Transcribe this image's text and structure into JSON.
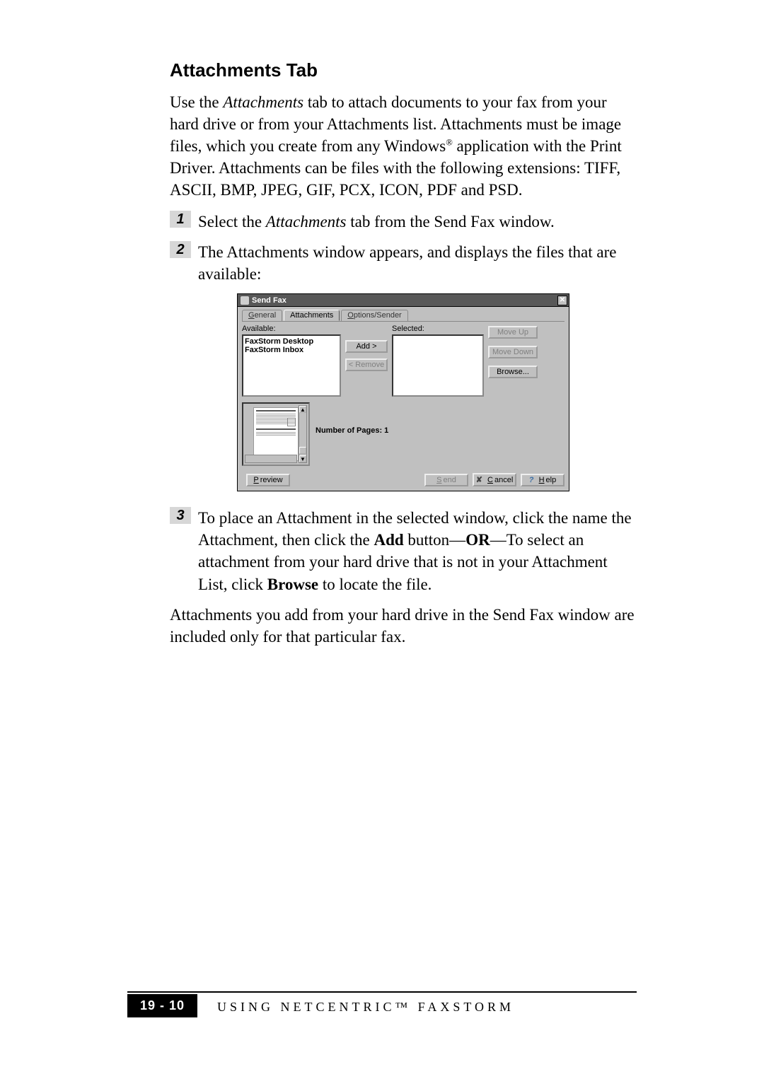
{
  "heading": "Attachments Tab",
  "intro_before_italic": "Use the ",
  "intro_italic": "Attachments",
  "intro_after_italic": " tab to attach documents to your fax from your hard drive or from your Attachments list. Attachments must be image files, which you create from any Windows",
  "intro_reg": "®",
  "intro_tail": " application with the Print Driver. Attachments can be files with the following extensions: TIFF, ASCII, BMP, JPEG, GIF, PCX, ICON, PDF and PSD.",
  "step1_num": "1",
  "step1_a": "Select the ",
  "step1_italic": "Attachments",
  "step1_b": " tab from the Send Fax window.",
  "step2_num": "2",
  "step2_text": "The Attachments window appears, and displays the files that are available:",
  "dialog": {
    "title": "Send Fax",
    "close_glyph": "✕",
    "tabs": {
      "general_g": "G",
      "general_rest": "eneral",
      "attachments": "Attachments",
      "options_o": "O",
      "options_rest": "ptions/Sender"
    },
    "available_label": "Available:",
    "selected_label": "Selected:",
    "available_items": [
      "FaxStorm Desktop",
      "FaxStorm Inbox"
    ],
    "btn_add": "Add >",
    "btn_remove": "< Remove",
    "btn_move_up": "Move Up",
    "btn_move_down": "Move Down",
    "btn_browse": "Browse...",
    "pages_label": "Number of Pages:  1",
    "btn_preview_p": "P",
    "btn_preview_rest": "review",
    "btn_send_s": "S",
    "btn_send_rest": "end",
    "btn_cancel_c": "C",
    "btn_cancel_rest": "ancel",
    "btn_help_h": "H",
    "btn_help_rest": "elp"
  },
  "step3_num": "3",
  "step3_a": "To place an Attachment in the selected window, click the name the Attachment, then click the ",
  "step3_bold1": "Add",
  "step3_b": " button—",
  "step3_bold2": "OR",
  "step3_c": "—To select an attachment from your hard drive that is not in your Attachment List, click ",
  "step3_bold3": "Browse",
  "step3_d": " to locate the file.",
  "closing": "Attachments you add from your hard drive in the Send Fax window are included only for that particular fax.",
  "page_number": "19 - 10",
  "footer_title": "USING NETCENTRIC™ FAXSTORM"
}
